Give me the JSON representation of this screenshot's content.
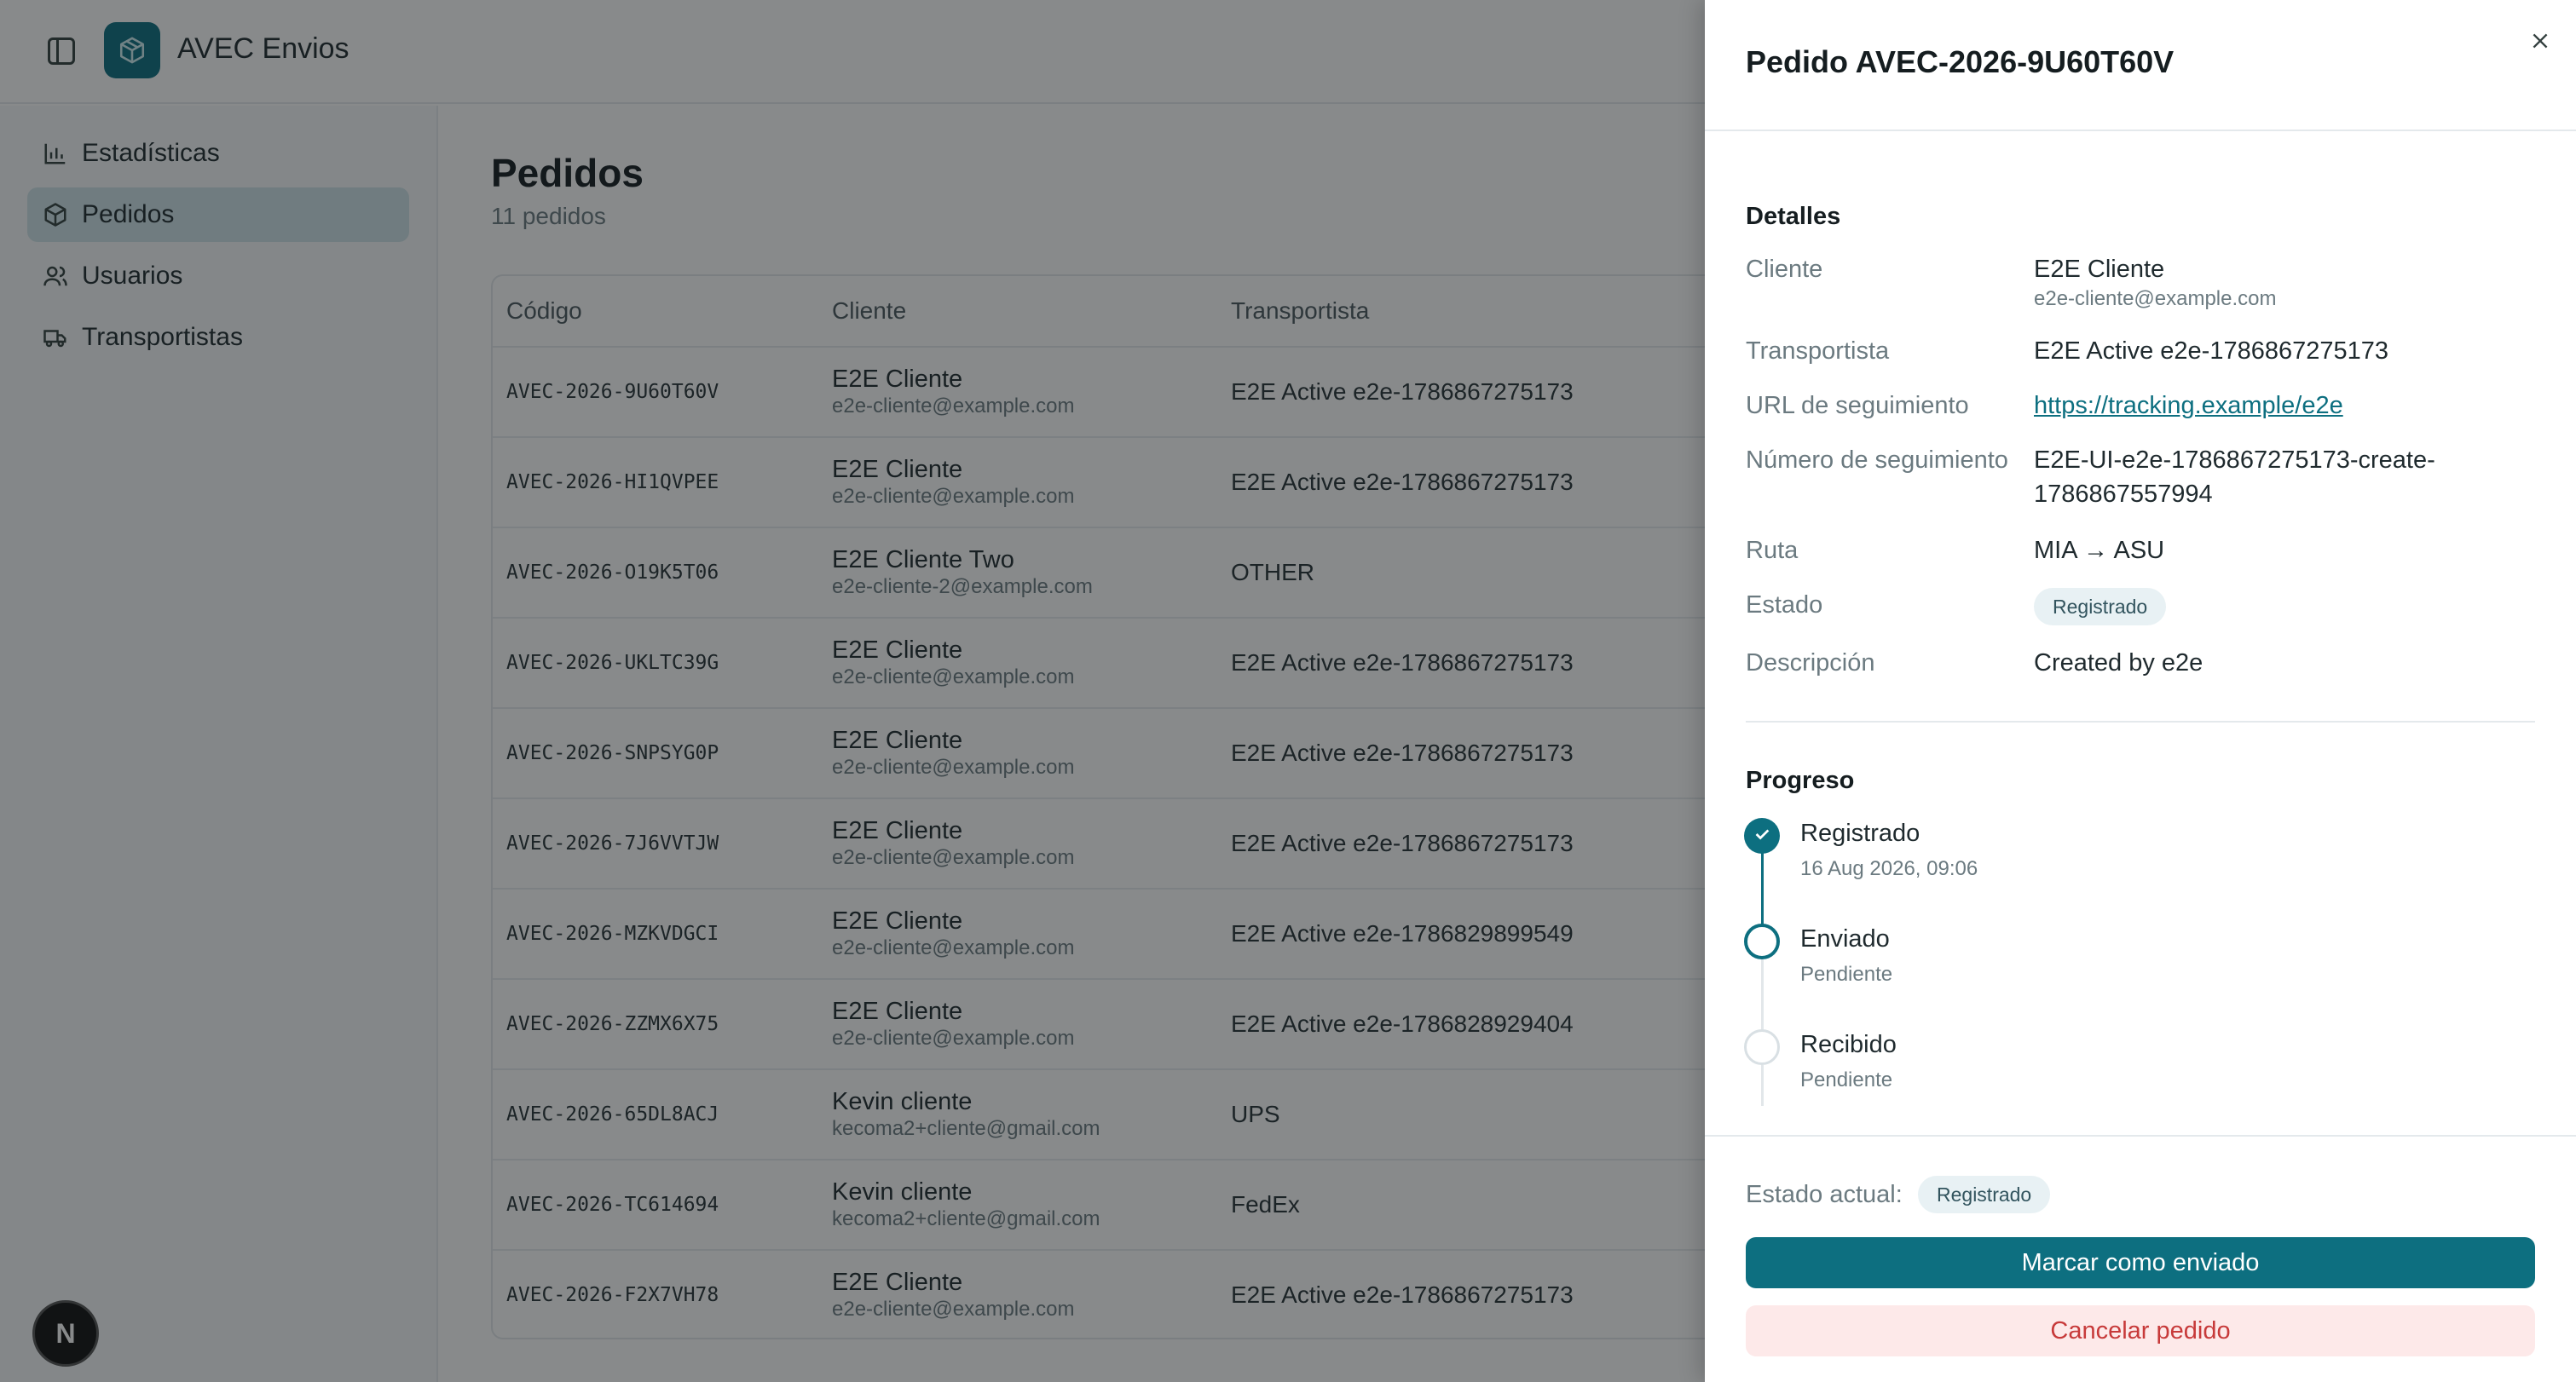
{
  "app": {
    "name": "AVEC Envios"
  },
  "sidebar": {
    "items": [
      {
        "label": "Estadísticas",
        "icon": "bar-chart-icon",
        "active": false
      },
      {
        "label": "Pedidos",
        "icon": "package-icon",
        "active": true
      },
      {
        "label": "Usuarios",
        "icon": "users-icon",
        "active": false
      },
      {
        "label": "Transportistas",
        "icon": "truck-icon",
        "active": false
      }
    ]
  },
  "main": {
    "title": "Pedidos",
    "count": "11 pedidos",
    "columns": [
      "Código",
      "Cliente",
      "Transportista"
    ],
    "rows": [
      {
        "code": "AVEC-2026-9U60T60V",
        "client": "E2E Cliente",
        "email": "e2e-cliente@example.com",
        "carrier": "E2E Active e2e-1786867275173"
      },
      {
        "code": "AVEC-2026-HI1QVPEE",
        "client": "E2E Cliente",
        "email": "e2e-cliente@example.com",
        "carrier": "E2E Active e2e-1786867275173"
      },
      {
        "code": "AVEC-2026-O19K5T06",
        "client": "E2E Cliente Two",
        "email": "e2e-cliente-2@example.com",
        "carrier": "OTHER"
      },
      {
        "code": "AVEC-2026-UKLTC39G",
        "client": "E2E Cliente",
        "email": "e2e-cliente@example.com",
        "carrier": "E2E Active e2e-1786867275173"
      },
      {
        "code": "AVEC-2026-SNPSYG0P",
        "client": "E2E Cliente",
        "email": "e2e-cliente@example.com",
        "carrier": "E2E Active e2e-1786867275173"
      },
      {
        "code": "AVEC-2026-7J6VVTJW",
        "client": "E2E Cliente",
        "email": "e2e-cliente@example.com",
        "carrier": "E2E Active e2e-1786867275173"
      },
      {
        "code": "AVEC-2026-MZKVDGCI",
        "client": "E2E Cliente",
        "email": "e2e-cliente@example.com",
        "carrier": "E2E Active e2e-1786829899549"
      },
      {
        "code": "AVEC-2026-ZZMX6X75",
        "client": "E2E Cliente",
        "email": "e2e-cliente@example.com",
        "carrier": "E2E Active e2e-1786828929404"
      },
      {
        "code": "AVEC-2026-65DL8ACJ",
        "client": "Kevin cliente",
        "email": "kecoma2+cliente@gmail.com",
        "carrier": "UPS"
      },
      {
        "code": "AVEC-2026-TC614694",
        "client": "Kevin cliente",
        "email": "kecoma2+cliente@gmail.com",
        "carrier": "FedEx"
      },
      {
        "code": "AVEC-2026-F2X7VH78",
        "client": "E2E Cliente",
        "email": "e2e-cliente@example.com",
        "carrier": "E2E Active e2e-1786867275173"
      }
    ]
  },
  "user_avatar": {
    "initial": "N"
  },
  "drawer": {
    "title": "Pedido AVEC-2026-9U60T60V",
    "details_title": "Detalles",
    "details": {
      "cliente_label": "Cliente",
      "cliente_name": "E2E Cliente",
      "cliente_email": "e2e-cliente@example.com",
      "transportista_label": "Transportista",
      "transportista_value": "E2E Active e2e-1786867275173",
      "url_label": "URL de seguimiento",
      "url_value": "https://tracking.example/e2e",
      "numero_label": "Número de seguimiento",
      "numero_line1": "E2E-UI-e2e-1786867275173-create-",
      "numero_line2": "1786867557994",
      "ruta_label": "Ruta",
      "ruta_value": "MIA → ASU",
      "estado_label": "Estado",
      "estado_value": "Registrado",
      "descripcion_label": "Descripción",
      "descripcion_value": "Created by e2e"
    },
    "progress_title": "Progreso",
    "steps": [
      {
        "label": "Registrado",
        "sub": "16 Aug 2026, 09:06",
        "state": "done"
      },
      {
        "label": "Enviado",
        "sub": "Pendiente",
        "state": "current"
      },
      {
        "label": "Recibido",
        "sub": "Pendiente",
        "state": "pending"
      }
    ],
    "footer": {
      "current_label": "Estado actual:",
      "current_value": "Registrado",
      "primary_button": "Marcar como enviado",
      "danger_button": "Cancelar pedido"
    }
  },
  "colors": {
    "accent": "#0d6f80",
    "danger_text": "#c73a3a",
    "danger_bg": "#fde9e9",
    "badge_bg": "#e8f1f4"
  }
}
